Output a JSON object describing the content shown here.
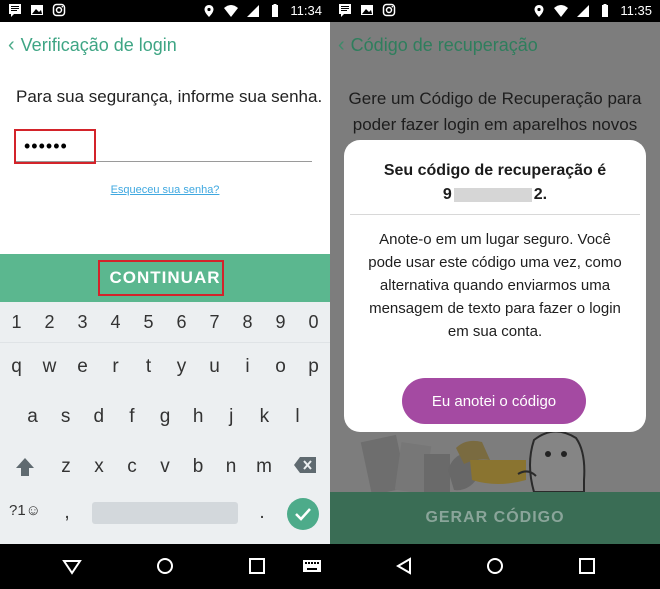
{
  "left": {
    "status": {
      "time": "11:34"
    },
    "appbar": {
      "title": "Verificação de login"
    },
    "prompt": "Para sua segurança, informe sua senha.",
    "password_value": "••••••",
    "forgot_link": "Esqueceu sua senha?",
    "continue_label": "CONTINUAR",
    "keyboard": {
      "digits": [
        "1",
        "2",
        "3",
        "4",
        "5",
        "6",
        "7",
        "8",
        "9",
        "0"
      ],
      "row1": [
        "q",
        "w",
        "e",
        "r",
        "t",
        "y",
        "u",
        "i",
        "o",
        "p"
      ],
      "row2": [
        "a",
        "s",
        "d",
        "f",
        "g",
        "h",
        "j",
        "k",
        "l"
      ],
      "row3": [
        "z",
        "x",
        "c",
        "v",
        "b",
        "n",
        "m"
      ],
      "symbols_label": "?1☺",
      "comma": ",",
      "period": "."
    }
  },
  "right": {
    "status": {
      "time": "11:35"
    },
    "appbar": {
      "title": "Código de recuperação"
    },
    "background_text": "Gere um Código de Recuperação para poder fazer login em aparelhos novos",
    "modal": {
      "title": "Seu código de recuperação é",
      "code_prefix": "9",
      "code_suffix": "2.",
      "body": "Anote-o em um lugar seguro. Você pode usar este código uma vez, como alternativa quando enviarmos uma mensagem de texto para fazer o login em sua conta.",
      "button_label": "Eu anotei o código"
    },
    "generate_label": "GERAR CÓDIGO"
  },
  "colors": {
    "accent_green": "#5bb78f",
    "title_green": "#3ea584",
    "highlight_red": "#d3232a",
    "modal_button_purple": "#a44aa2",
    "link_blue": "#3fa8e0"
  },
  "icons": {
    "status_left": [
      "message-icon",
      "image-icon",
      "instagram-icon"
    ],
    "status_right": [
      "location-icon",
      "wifi-icon",
      "signal-icon",
      "battery-icon"
    ],
    "keyboard": [
      "shift-icon",
      "backspace-icon",
      "check-icon"
    ],
    "navbar": [
      "back-icon",
      "home-icon",
      "recents-icon",
      "keyboard-icon"
    ]
  }
}
